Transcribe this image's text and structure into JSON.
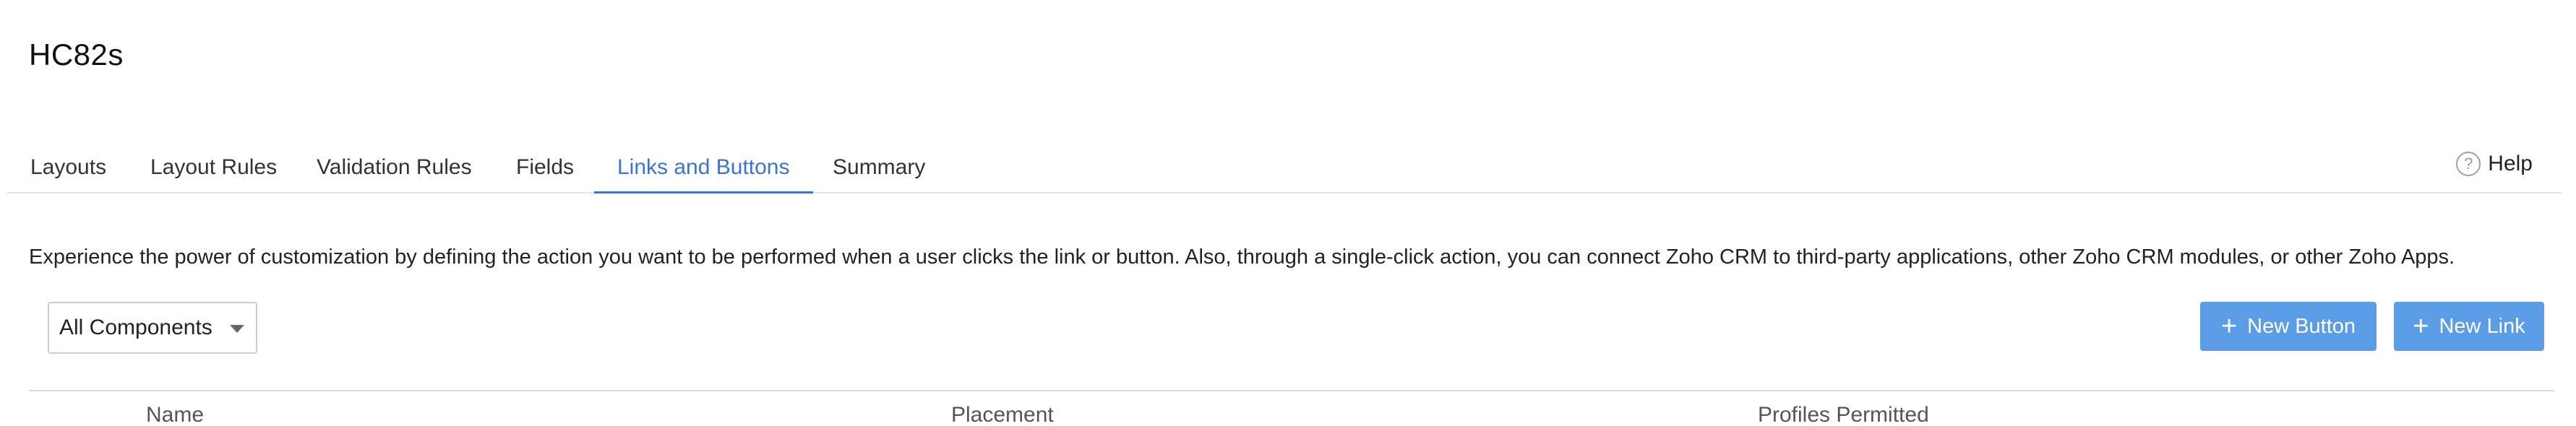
{
  "module": {
    "title": "HC82s"
  },
  "tabs": [
    {
      "label": "Layouts",
      "active": false
    },
    {
      "label": "Layout Rules",
      "active": false
    },
    {
      "label": "Validation Rules",
      "active": false
    },
    {
      "label": "Fields",
      "active": false
    },
    {
      "label": "Links and Buttons",
      "active": true
    },
    {
      "label": "Summary",
      "active": false
    }
  ],
  "help": {
    "icon": "question-circle-icon",
    "glyph": "?",
    "label": "Help"
  },
  "description": "Experience the power of customization by defining the action you want to be performed when a user clicks the link or button. Also, through a single-click action, you can connect Zoho CRM to third-party applications, other Zoho CRM modules, or other Zoho Apps.",
  "filter": {
    "selected": "All Components",
    "icon": "chevron-down-icon"
  },
  "actions": {
    "new_button": {
      "label": "New Button",
      "icon": "plus-icon",
      "glyph": "+"
    },
    "new_link": {
      "label": "New Link",
      "icon": "plus-icon",
      "glyph": "+"
    }
  },
  "table": {
    "columns": [
      "Name",
      "Placement",
      "Profiles Permitted"
    ]
  },
  "colors": {
    "accent": "#3b73d4",
    "button_bg": "#5b9ce6",
    "border": "#d8dce2"
  }
}
